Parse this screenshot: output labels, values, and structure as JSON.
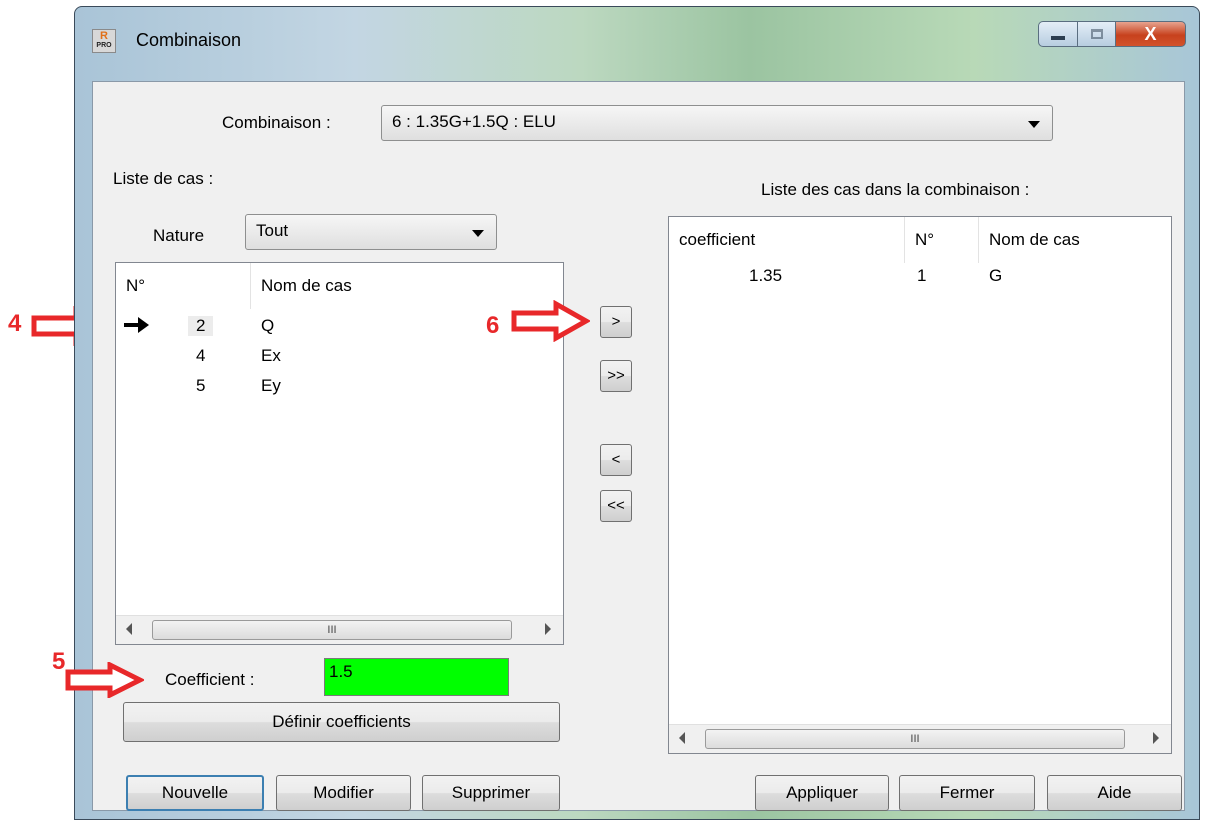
{
  "window": {
    "title": "Combinaison"
  },
  "combination": {
    "label": "Combinaison :",
    "selected": "6 : 1.35G+1.5Q : ELU"
  },
  "left_panel": {
    "title": "Liste de cas :",
    "nature_label": "Nature",
    "nature_selected": "Tout",
    "columns": [
      "N°",
      "Nom de cas"
    ],
    "rows": [
      {
        "num": "2",
        "name": "Q",
        "current": true
      },
      {
        "num": "4",
        "name": "Ex",
        "current": false
      },
      {
        "num": "5",
        "name": "Ey",
        "current": false
      }
    ],
    "coefficient_label": "Coefficient :",
    "coefficient_value": "1.5",
    "define_button": "Définir coefficients"
  },
  "transfer_buttons": {
    "add": ">",
    "add_all": ">>",
    "remove": "<",
    "remove_all": "<<"
  },
  "right_panel": {
    "title": "Liste des cas dans la combinaison :",
    "columns": [
      "coefficient",
      "N°",
      "Nom de cas"
    ],
    "rows": [
      {
        "coefficient": "1.35",
        "num": "1",
        "name": "G"
      }
    ]
  },
  "scroll_thumb_glyph": "III",
  "buttons": {
    "nouvelle": "Nouvelle",
    "modifier": "Modifier",
    "supprimer": "Supprimer",
    "appliquer": "Appliquer",
    "fermer": "Fermer",
    "aide": "Aide"
  },
  "window_close_glyph": "X",
  "app_icon_text": {
    "top": "R",
    "bottom": "PRO"
  },
  "annotations": [
    "4",
    "5",
    "6"
  ],
  "colors": {
    "coefficient_bg": "#00ff00",
    "annotation": "#e8282a"
  }
}
